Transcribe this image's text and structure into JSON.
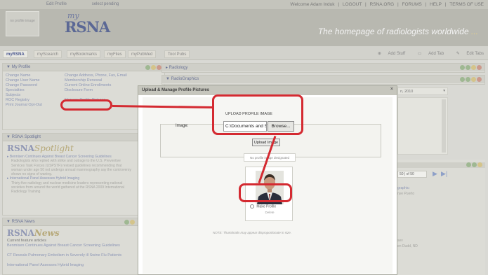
{
  "topbar": {
    "edit_profile": "Edit Profile",
    "upload_pending": "select pending",
    "welcome": "Welcome Adam Induk",
    "logout": "LOGOUT",
    "rsna_org": "RSNA.ORG",
    "forums": "FORUMS",
    "help": "HELP",
    "terms": "TERMS OF USE",
    "sep": "|"
  },
  "avatar_text": "no profile image",
  "logo": {
    "my": "my",
    "rsna": "RSNA"
  },
  "tagline": {
    "text": "The homepage of radiologists worldwide",
    "cut": "..."
  },
  "tabs": [
    "myRSNA",
    "myScearch",
    "myBookmarks",
    "myFiles",
    "myPubMed",
    "Tool Pubs"
  ],
  "tools": {
    "add_stuff": "Add Stuff",
    "add_tab": "Add Tab",
    "edit_tabs": "Edit Tabs"
  },
  "profile_panel": {
    "title": "▼ My Profile",
    "col1": [
      "Change Name",
      "Change User Name",
      "Change Password",
      "Specialties",
      "Subjects",
      "ROC Registry",
      "Print Journal Opt-Out"
    ],
    "col2": [
      "Change Address, Phone, Fax, Email",
      "Membership Renewal",
      "Current Online Enrollments",
      "Disclosure Form",
      "",
      "Manage Profile Pictures"
    ]
  },
  "spotlight_panel": {
    "title": "▼ RSNA Spotlight",
    "logo_main": "RSNA",
    "logo_italic": "Spotlight",
    "items": [
      "▸ Bennisen Continues Against Breast Cancer Screening Guidelines",
      "Radiologists who replied with strike and outrage to the U.S. Preventive Services Task Forces (USPSTF) revised guidelines recommending that woman under age 50 not undergo annual mammography say the controversy shows no signs of waning.",
      "▸ International Panel Assesses Hybrid Imaging",
      "Thirty-five radiology and nuclear medicine leaders representing national societies from around the world gathered at the RSNA 2009 International Radiology Training"
    ]
  },
  "news_panel": {
    "title": "▼ RSNA News",
    "logo_main": "RSNA",
    "logo_italic": "News",
    "items": [
      "Current feature articles",
      "Benmisen Continues Against Breast Cancer Screening Guidelines",
      "",
      "CT Reveals Pulmonary Embolism in Severely ill Swine Flu Patients",
      "",
      "International Panel Assesses Hybrid Imaging"
    ]
  },
  "radiology_panel": {
    "title": "▸ Radiology"
  },
  "radiographics_panel": {
    "title": "▼ RadioGraphics"
  },
  "right_bits": {
    "date": "n, 2010",
    "pager": "50 | of 50",
    "link1": "graphic:",
    "text1": "nye Puerto",
    "text2": "sev",
    "text3": "en Dudd, ND"
  },
  "modal": {
    "title": "Upload & Manage Profile Pictures",
    "close": "×",
    "upload_title": "UPLOAD PROFILE IMAGE",
    "image_label": "Image:",
    "file_value": "C:\\Documents and Se",
    "browse": "Browse...",
    "upload_button": "Upload Image",
    "no_image": "No profile image designated",
    "radio_label": "Make Profile",
    "photo_sub": "Delete",
    "note": "NOTE: Thumbnails may appear disproportionate in size."
  },
  "colors": {
    "accent_red": "#d42a31",
    "brand_blue": "#5b6895"
  }
}
